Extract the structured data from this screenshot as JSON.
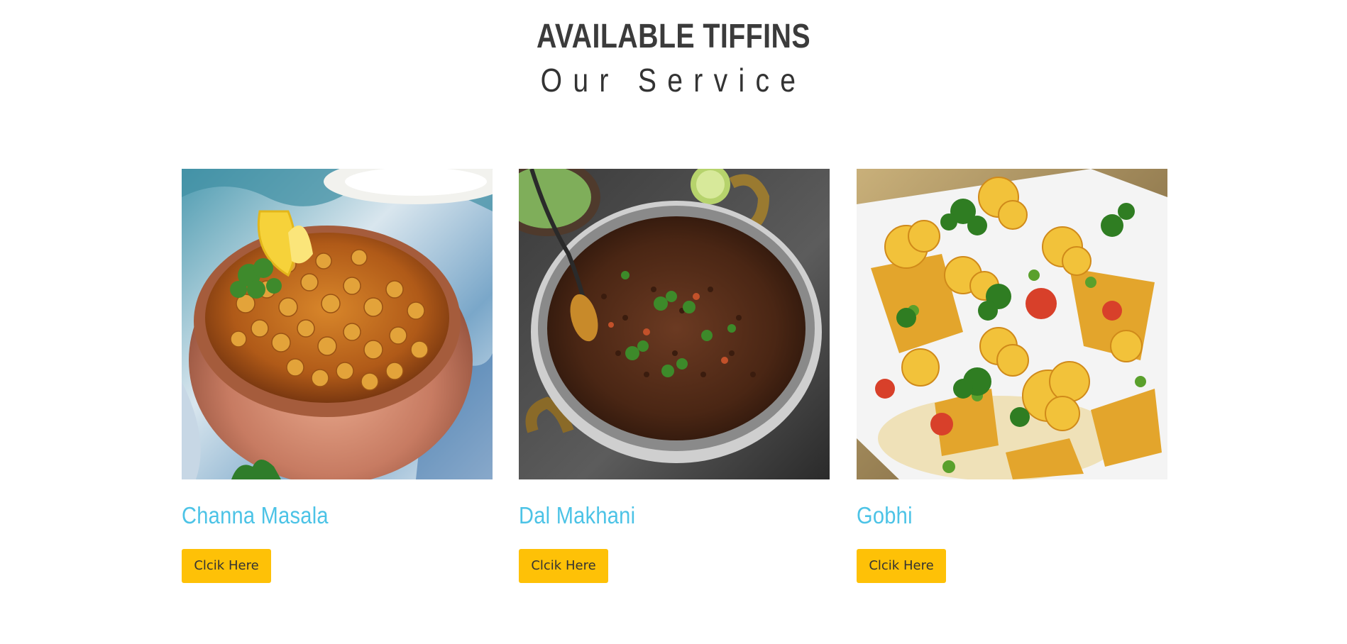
{
  "section": {
    "title": "AVAILABLE TIFFINS",
    "subtitle": "Our Service"
  },
  "cards": [
    {
      "name": "Channa Masala",
      "button_label": "Clcik Here",
      "image_icon": "channa-masala-photo"
    },
    {
      "name": "Dal Makhani",
      "button_label": "Clcik Here",
      "image_icon": "dal-makhani-photo"
    },
    {
      "name": "Gobhi",
      "button_label": "Clcik Here",
      "image_icon": "gobhi-photo"
    }
  ],
  "colors": {
    "title": "#3b3b3b",
    "card_title": "#4cc3e6",
    "button_bg": "#fec107",
    "button_text": "#333333"
  }
}
